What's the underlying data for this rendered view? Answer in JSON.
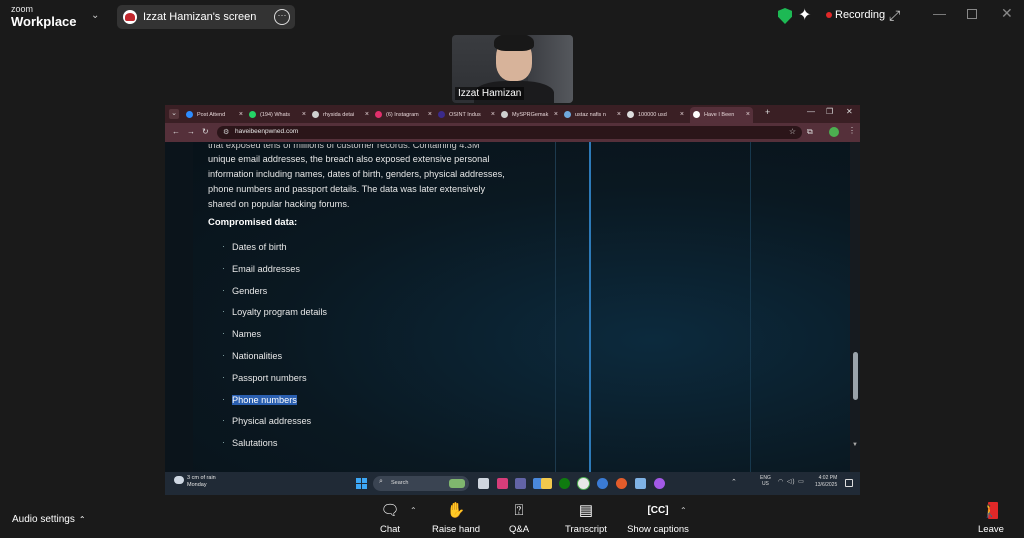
{
  "zoom": {
    "logo_line1": "zoom",
    "logo_line2": "Workplace",
    "share_title": "Izzat Hamizan's screen",
    "recording_label": "Recording",
    "participant_name": "Izzat Hamizan",
    "status_colors": {
      "recording": "#e02828",
      "shield": "#1db954"
    }
  },
  "browser": {
    "tabs": [
      {
        "label": "Post Attend",
        "icon": "zoom-icon",
        "color": "#2d8cff"
      },
      {
        "label": "(194) Whats",
        "icon": "whatsapp-icon",
        "color": "#25d366"
      },
      {
        "label": "rhysida detai",
        "icon": "web-icon",
        "color": "#cfcfcf"
      },
      {
        "label": "(6) Instagram",
        "icon": "instagram-icon",
        "color": "#e1306c"
      },
      {
        "label": "OSINT Indus",
        "icon": "osint-icon",
        "color": "#3b2a8a"
      },
      {
        "label": "MySPRGemak",
        "icon": "web-icon",
        "color": "#cfcfcf"
      },
      {
        "label": "ustaz nafis n",
        "icon": "web-icon",
        "color": "#6fa8dc"
      },
      {
        "label": "100000 usd",
        "icon": "google-icon",
        "color": "#dddddd"
      },
      {
        "label": "Have I Been",
        "icon": "hibp-icon",
        "color": "#ffffff",
        "active": true
      }
    ],
    "url": "haveibeenpwned.com"
  },
  "page": {
    "intro_clipped": "that exposed tens of millions of customer records. Containing 4.3M",
    "intro_lines": [
      "unique email addresses, the breach also exposed extensive personal",
      "information including names, dates of birth, genders, physical addresses,",
      "phone numbers and passport details. The data was later extensively",
      "shared on popular hacking forums."
    ],
    "section_title": "Compromised data:",
    "items": [
      "Dates of birth",
      "Email addresses",
      "Genders",
      "Loyalty program details",
      "Names",
      "Nationalities",
      "Passport numbers",
      "Phone numbers",
      "Physical addresses",
      "Salutations"
    ],
    "highlighted_item": "Phone numbers",
    "highlight_color": "#2a5fb0"
  },
  "taskbar": {
    "weather_line1": "3 cm of rain",
    "weather_line2": "Monday",
    "search_placeholder": "Search",
    "lang_line1": "ENG",
    "lang_line2": "US",
    "time": "4:02 PM",
    "date": "13/6/2025"
  },
  "toolbar": {
    "audio_settings": "Audio settings",
    "chat": "Chat",
    "raise_hand": "Raise hand",
    "qa": "Q&A",
    "transcript": "Transcript",
    "show_captions": "Show captions",
    "leave": "Leave"
  }
}
